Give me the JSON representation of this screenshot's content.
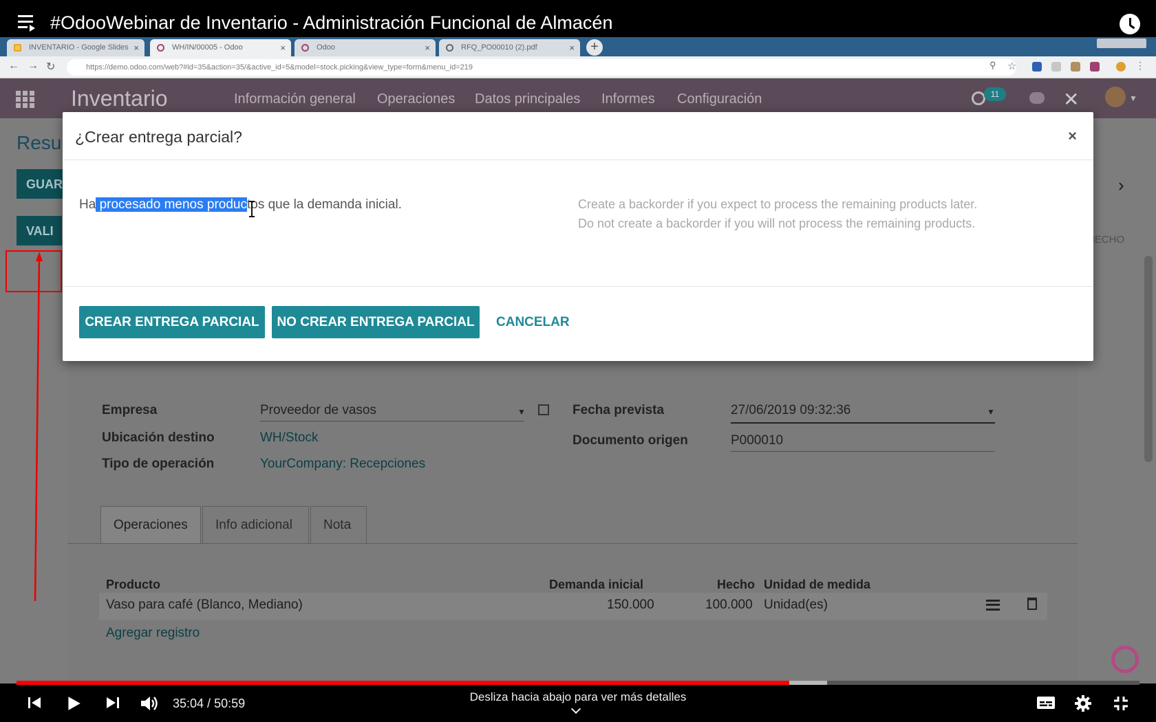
{
  "youtube": {
    "title": "#OdooWebinar de Inventario - Administración Funcional de Almacén",
    "time_current": "35:04",
    "time_separator": " / ",
    "time_total": "50:59",
    "scroll_hint": "Desliza hacia abajo para ver más detalles",
    "progress_fraction": 0.688,
    "buffered_fraction": 0.722,
    "icons": [
      "playlist-icon",
      "watch-later-icon",
      "previous-icon",
      "play-icon",
      "next-icon",
      "volume-icon",
      "subtitles-icon",
      "settings-icon",
      "exit-fullscreen-icon"
    ]
  },
  "browser": {
    "tabs": [
      {
        "label": "INVENTARIO - Google Slides",
        "icon": "slides-icon"
      },
      {
        "label": "WH/IN/00005 - Odoo",
        "icon": "odoo-icon"
      },
      {
        "label": "Odoo",
        "icon": "odoo-icon"
      },
      {
        "label": "RFQ_PO00010 (2).pdf",
        "icon": "globe-icon"
      }
    ],
    "url": "https://demo.odoo.com/web?#id=35&action=35/&active_id=5&model=stock.picking&view_type=form&menu_id=219"
  },
  "odoo": {
    "app_name": "Inventario",
    "menu": [
      "Información general",
      "Operaciones",
      "Datos principales",
      "Informes",
      "Configuración"
    ],
    "activity_count": "11",
    "background": {
      "breadcrumb": "Resu",
      "save_button": "GUAR",
      "validate_button": "VALI",
      "status": "HECHO",
      "fields": {
        "empresa_label": "Empresa",
        "empresa_value": "Proveedor de vasos",
        "ubicacion_label": "Ubicación destino",
        "ubicacion_value": "WH/Stock",
        "tipo_label": "Tipo de operación",
        "tipo_value": "YourCompany: Recepciones",
        "fecha_label": "Fecha prevista",
        "fecha_value": "27/06/2019 09:32:36",
        "origen_label": "Documento origen",
        "origen_value": "P000010"
      },
      "tabs": [
        "Operaciones",
        "Info adicional",
        "Nota"
      ],
      "table": {
        "headers": [
          "Producto",
          "Demanda inicial",
          "Hecho",
          "Unidad de medida"
        ],
        "rows": [
          {
            "producto": "Vaso para café (Blanco, Mediano)",
            "demanda": "150.000",
            "hecho": "100.000",
            "unidad": "Unidad(es)"
          }
        ],
        "add_line": "Agregar registro"
      }
    },
    "dialog": {
      "title": "¿Crear entrega parcial?",
      "close": "×",
      "message_before": "Ha",
      "message_highlight": " procesado menos produc",
      "message_after": "tos que la demanda inicial.",
      "help_line1": "Create a backorder if you expect to process the remaining products later.",
      "help_line2": "Do not create a backorder if you will not process the remaining products.",
      "btn_create": "CREAR ENTREGA PARCIAL",
      "btn_no_create": "NO CREAR ENTREGA PARCIAL",
      "btn_cancel": "CANCELAR"
    }
  },
  "colors": {
    "odoo_purple": "#5b4b58",
    "odoo_teal": "#1e8a96",
    "selection": "#2a7df2",
    "annotation_red": "#e00000",
    "youtube_red": "#ff0000"
  }
}
